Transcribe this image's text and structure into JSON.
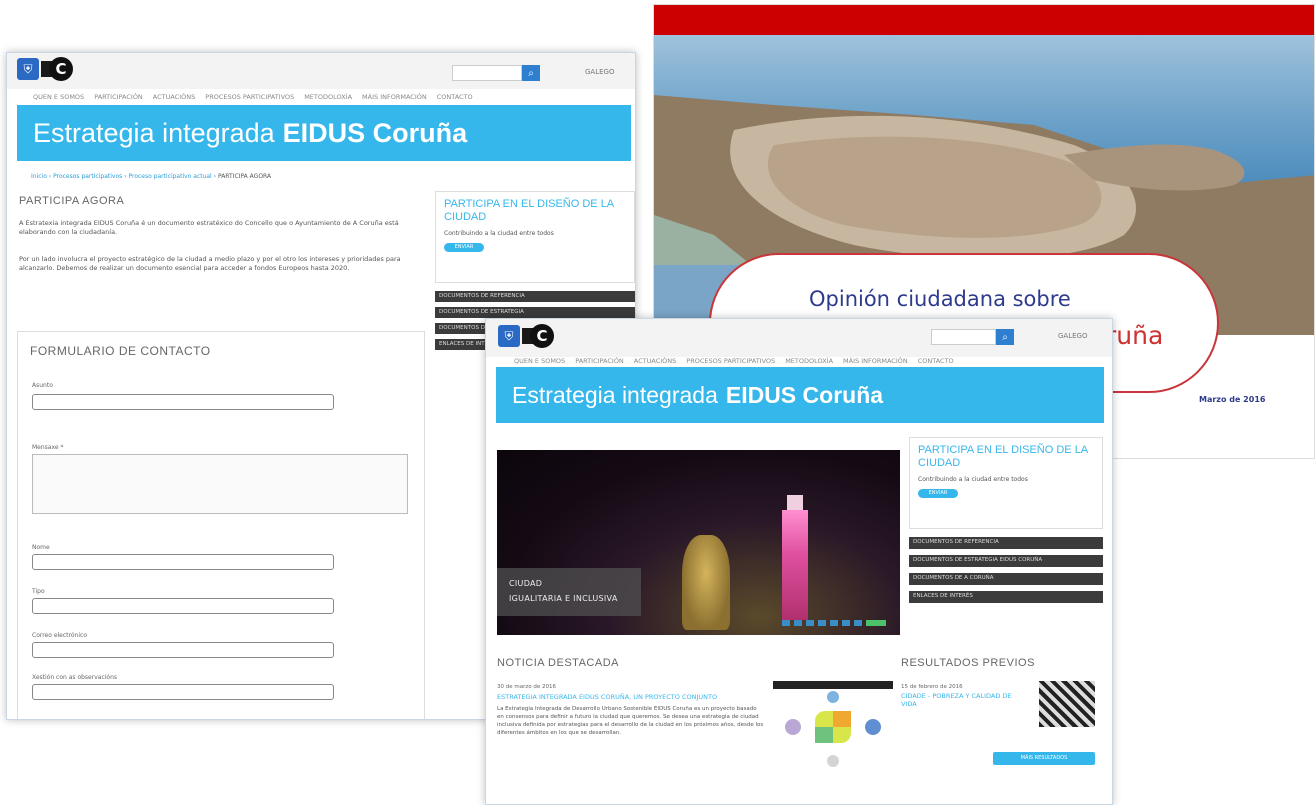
{
  "left_page": {
    "lang": "GALEGO",
    "nav": [
      "QUEN E SOMOS",
      "PARTICIPACIÓN",
      "ACTUACIÓNS",
      "PROCESOS PARTICIPATIVOS",
      "METODOLOXÍA",
      "MÁIS INFORMACIÓN",
      "CONTACTO"
    ],
    "banner_light": "Estrategia integrada",
    "banner_bold": "EIDUS Coruña",
    "breadcrumb": [
      "Inicio",
      "Procesos participativos",
      "Proceso participativo actual",
      "PARTICIPA AGORA"
    ],
    "section_title": "PARTICIPA AGORA",
    "paragraph1": "A Estratexia integrada EIDUS Coruña é un documento estratéxico do Concello que o Ayuntamiento de A Coruña está elaborando con la ciudadanía.",
    "paragraph2": "Por un lado involucra el proyecto estratégico de la ciudad a medio plazo y por el otro los intereses y prioridades para alcanzarlo. Debemos de realizar un documento esencial para acceder a fondos Europeos hasta 2020.",
    "side_title": "PARTICIPA EN EL DISEÑO DE LA CIUDAD",
    "side_sub": "Contribuindo a la ciudad entre todos",
    "side_btn": "ENVIAR",
    "side_links": [
      "DOCUMENTOS DE REFERENCIA",
      "DOCUMENTOS DE ESTRATEGIA",
      "DOCUMENTOS DE A CORUÑA",
      "ENLACES DE INTERÉS"
    ],
    "form_title": "FORMULARIO DE CONTACTO",
    "fields": [
      "Asunto",
      "Mensaxe *",
      "Nome",
      "Tipo",
      "Correo electrónico",
      "Xestión con as observacións"
    ]
  },
  "right_page": {
    "title_line1": "Opinión ciudadana sobre",
    "title_line2": "ruña",
    "date": "Marzo de 2016"
  },
  "front_page": {
    "lang": "GALEGO",
    "nav": [
      "QUEN E SOMOS",
      "PARTICIPACIÓN",
      "ACTUACIÓNS",
      "PROCESOS PARTICIPATIVOS",
      "METODOLOXÍA",
      "MÁIS INFORMACIÓN",
      "CONTACTO"
    ],
    "banner_light": "Estrategia integrada",
    "banner_bold": "EIDUS Coruña",
    "side_title": "PARTICIPA EN EL DISEÑO DE LA CIUDAD",
    "side_sub": "Contribuindo a la ciudad entre todos",
    "side_btn": "ENVIAR",
    "side_links": [
      "DOCUMENTOS DE REFERENCIA",
      "DOCUMENTOS DE ESTRATEGIA EIDUS CORUÑA",
      "DOCUMENTOS DE A CORUÑA",
      "ENLACES DE INTERÉS"
    ],
    "caption_line1": "CIUDAD",
    "caption_line2": "IGUALITARIA E INCLUSIVA",
    "news_title": "NOTICIA DESTACADA",
    "news_date": "30 de marzo de 2016",
    "news_headline": "ESTRATEGIA INTEGRADA EIDUS CORUÑA, UN PROYECTO CONJUNTO",
    "news_body": "La Estrategia Integrada de Desarrollo Urbano Sostenible EIDUS Coruña es un proyecto basado en consensos para definir a futuro la ciudad que queremos. Se desea una estrategia de ciudad inclusiva definida por estrategias para el desarrollo de la ciudad en los próximos años, desde los diferentes ámbitos en los que se desarrollan.",
    "results_title": "RESULTADOS PREVIOS",
    "results_date": "15 de febrero de 2016",
    "results_link": "CIDADE - POBREZA Y CALIDAD DE VIDA",
    "results_btn": "MÁIS RESULTADOS"
  }
}
